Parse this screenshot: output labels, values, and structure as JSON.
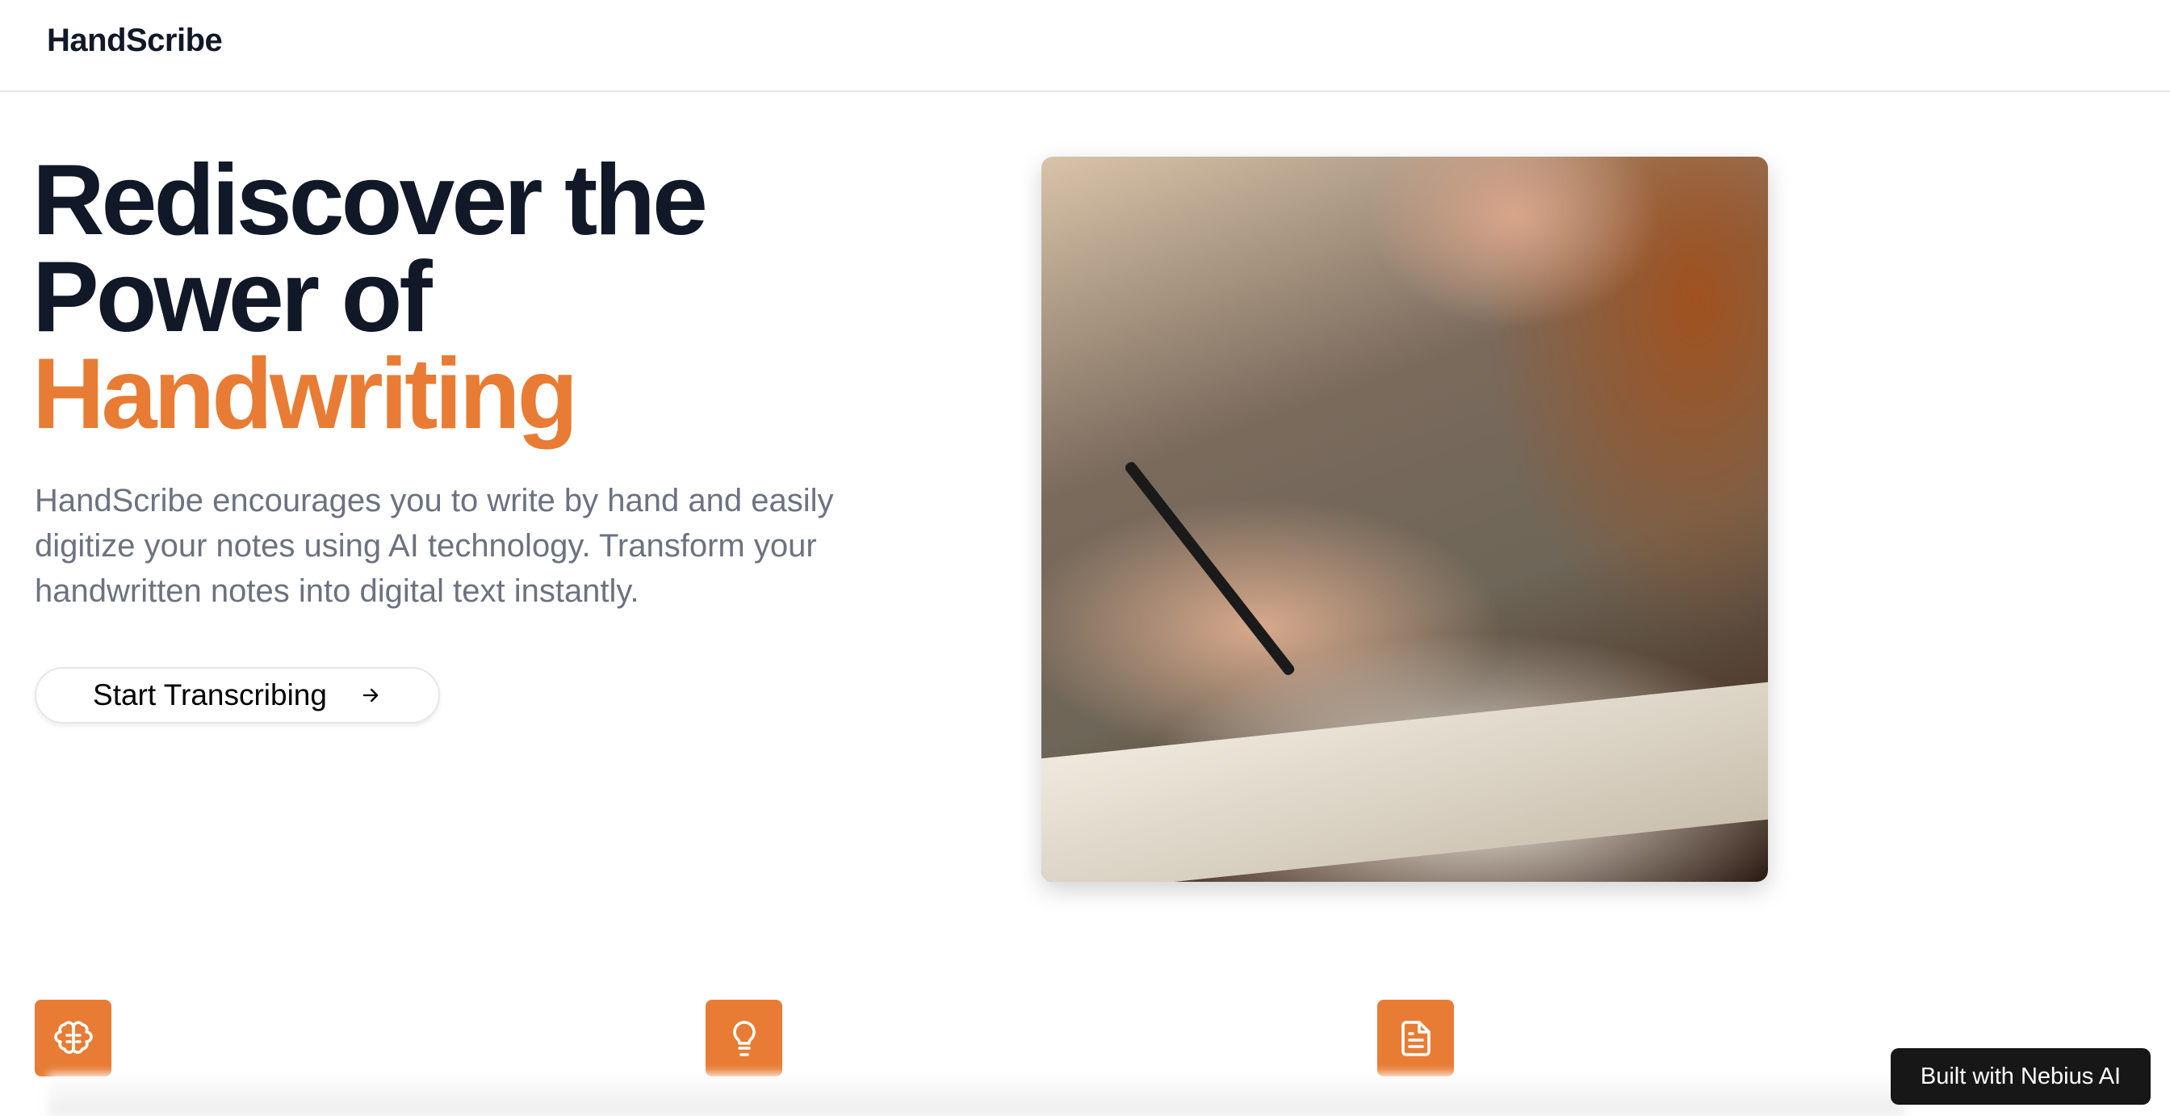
{
  "header": {
    "brand": "HandScribe"
  },
  "hero": {
    "headline_line1": "Rediscover the",
    "headline_line2": "Power of",
    "headline_accent": "Handwriting",
    "description": "HandScribe encourages you to write by hand and easily digitize your notes using AI technology. Transform your handwritten notes into digital text instantly.",
    "cta_label": "Start Transcribing",
    "cta_icon": "arrow-right-icon",
    "image_alt": "Woman writing by hand in a notebook"
  },
  "features": [
    {
      "icon": "brain-icon"
    },
    {
      "icon": "lightbulb-icon"
    },
    {
      "icon": "file-text-icon"
    }
  ],
  "badge": {
    "label": "Built with Nebius AI"
  },
  "colors": {
    "accent": "#e87c34",
    "heading": "#111827",
    "body": "#6b7280",
    "badge_bg": "#171717"
  }
}
